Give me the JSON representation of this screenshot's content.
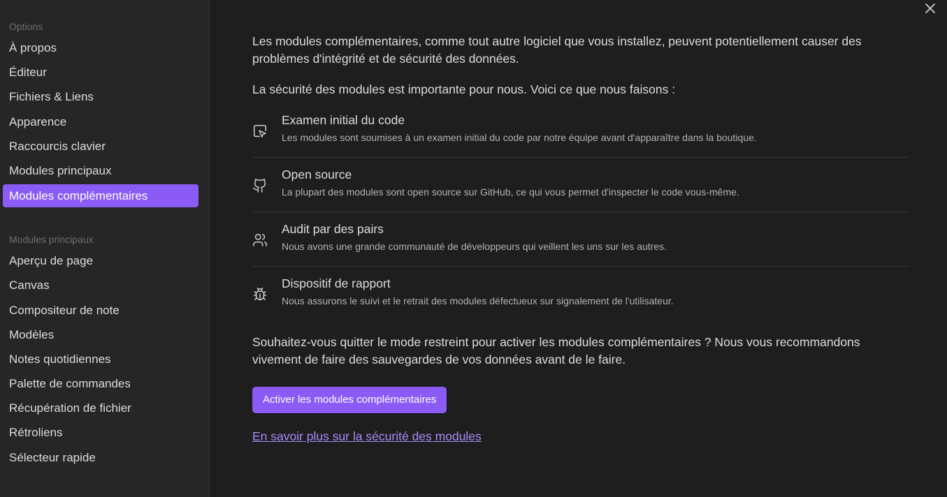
{
  "sidebar": {
    "section1_title": "Options",
    "items1": [
      {
        "label": "À propos"
      },
      {
        "label": "Éditeur"
      },
      {
        "label": "Fichiers & Liens"
      },
      {
        "label": "Apparence"
      },
      {
        "label": "Raccourcis clavier"
      },
      {
        "label": "Modules principaux"
      },
      {
        "label": "Modules complémentaires"
      }
    ],
    "active_item": "Modules complémentaires",
    "section2_title": "Modules principaux",
    "items2": [
      {
        "label": "Aperçu de page"
      },
      {
        "label": "Canvas"
      },
      {
        "label": "Compositeur de note"
      },
      {
        "label": "Modèles"
      },
      {
        "label": "Notes quotidiennes"
      },
      {
        "label": "Palette de commandes"
      },
      {
        "label": "Récupération de fichier"
      },
      {
        "label": "Rétroliens"
      },
      {
        "label": "Sélecteur rapide"
      }
    ]
  },
  "main": {
    "intro": "Les modules complémentaires, comme tout autre logiciel que vous installez, peuvent potentiellement causer des problèmes d'intégrité et de sécurité des données.",
    "security_intro": "La sécurité des modules est importante pour nous. Voici ce que nous faisons :",
    "features": [
      {
        "icon": "cursor-review-icon",
        "title": "Examen initial du code",
        "desc": "Les modules sont soumises à un examen initial du code par notre équipe avant d'apparaître dans la boutique."
      },
      {
        "icon": "github-icon",
        "title": "Open source",
        "desc": "La plupart des modules sont open source sur GitHub, ce qui vous permet d'inspecter le code vous-même."
      },
      {
        "icon": "users-icon",
        "title": "Audit par des pairs",
        "desc": "Nous avons une grande communauté de développeurs qui veillent les uns sur les autres."
      },
      {
        "icon": "bug-icon",
        "title": "Dispositif de rapport",
        "desc": "Nous assurons le suivi et le retrait des modules défectueux sur signalement de l'utilisateur."
      }
    ],
    "question": "Souhaitez-vous quitter le mode restreint pour activer les modules complémentaires ? Nous vous recommandons vivement de faire des sauvegardes de vos données avant de le faire.",
    "activate_button": "Activer les modules complémentaires",
    "learn_more_link": "En savoir plus sur la sécurité des modules"
  },
  "colors": {
    "accent": "#8a5cf5",
    "link": "#a88bfa",
    "background": "#1e1e1e",
    "sidebar": "#262626"
  }
}
